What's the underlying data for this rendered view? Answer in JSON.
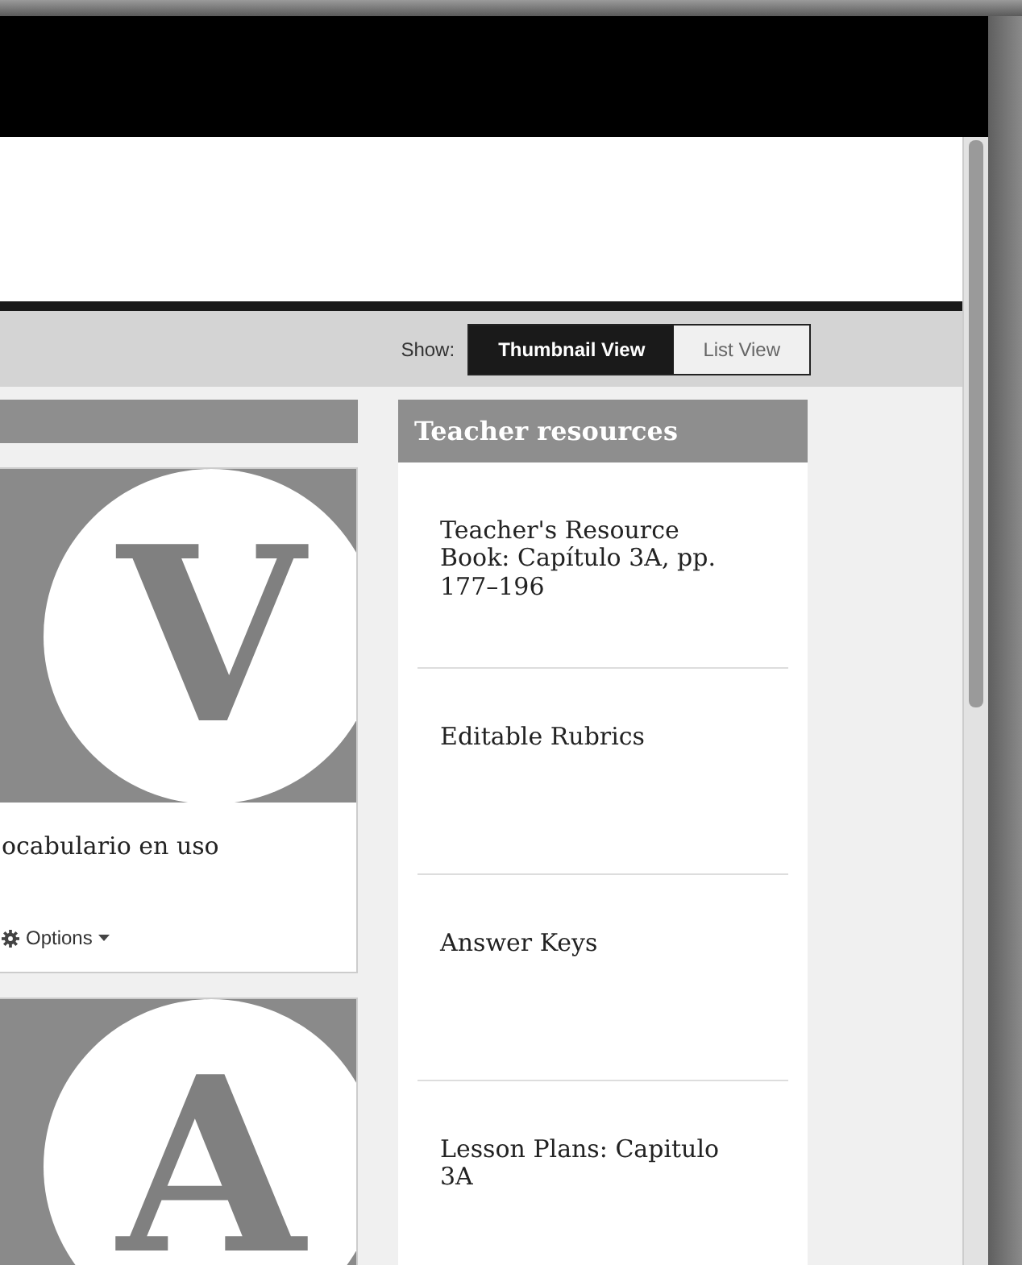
{
  "toolbar": {
    "show_label": "Show:",
    "views": [
      {
        "label": "Thumbnail View",
        "selected": true
      },
      {
        "label": "List View",
        "selected": false
      }
    ]
  },
  "cards": [
    {
      "letter": "V",
      "title": "ocabulario en uso",
      "options": "Options"
    },
    {
      "letter": "A"
    }
  ],
  "teacher_resources": {
    "title": "Teacher resources",
    "items": [
      "Teacher's Resource Book: Capítulo 3A, pp. 177–196",
      "Editable Rubrics",
      "Answer Keys",
      "Lesson Plans: Capitulo 3A"
    ]
  }
}
